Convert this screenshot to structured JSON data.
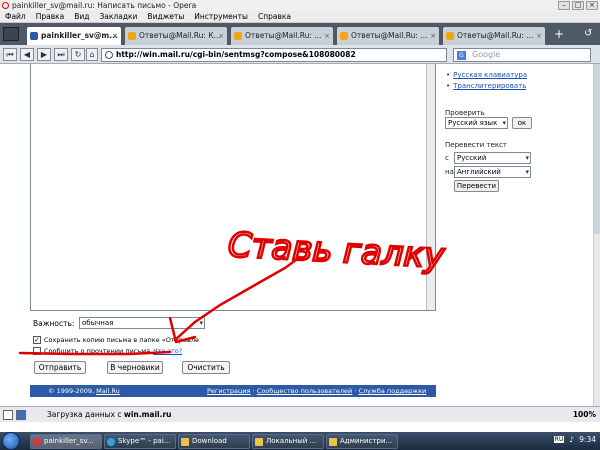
{
  "window": {
    "title": "painkiller_sv@mail.ru: Написать письмо - Opera"
  },
  "menu": [
    "Файл",
    "Правка",
    "Вид",
    "Закладки",
    "Виджеты",
    "Инструменты",
    "Справка"
  ],
  "tabs": [
    {
      "label": "painkiller_sv@m...",
      "active": true
    },
    {
      "label": "Ответы@Mail.Ru: К...",
      "active": false
    },
    {
      "label": "Ответы@Mail.Ru: ...",
      "active": false
    },
    {
      "label": "Ответы@Mail.Ru: ...",
      "active": false
    },
    {
      "label": "Ответы@Mail.Ru: ...",
      "active": false
    }
  ],
  "address": {
    "url": "http://win.mail.ru/cgi-bin/sentmsg?compose&108080082"
  },
  "search": {
    "placeholder": "Google"
  },
  "sidebar": {
    "link_keyboard": "Русская клавиатура",
    "link_translit": "Транслитерировать",
    "check_label": "Проверить",
    "check_lang": "Русский язык",
    "check_ok": "ок",
    "translate_label": "Перевести текст",
    "from_prefix": "с",
    "from_lang": "Русский",
    "to_prefix": "на",
    "to_lang": "Английский",
    "translate_btn": "Перевести"
  },
  "form": {
    "importance_label": "Важность:",
    "importance_value": "обычная",
    "save_copy": "Сохранить копию письма в папке «Отправле",
    "notify_read": "Сообщить о прочтении письма",
    "what_is": "Что это?",
    "send_btn": "Отправить",
    "draft_btn": "В черновики",
    "clear_btn": "Очистить"
  },
  "footer": {
    "copyright": "© 1999-2009, ",
    "copyright_link": "Mail.Ru",
    "link_reg": "Регистрация",
    "link_community": "Сообщество пользователей",
    "link_support": "Служба поддержки",
    "sep": " · "
  },
  "status": {
    "loading_prefix": "Загрузка данных с ",
    "loading_host": "win.mail.ru",
    "zoom": "100%"
  },
  "taskbar": {
    "tasks": [
      "painkiller_sv...",
      "Skype™ - pai...",
      "Download",
      "Локальный ...",
      "Администри..."
    ],
    "lang": "RU",
    "time": "9:34"
  },
  "annotation": {
    "text": "Ставь галку",
    "color": "#e00000"
  }
}
